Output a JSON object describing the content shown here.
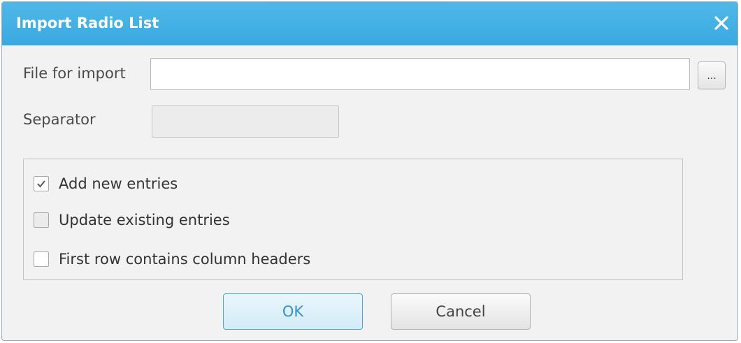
{
  "dialog": {
    "title": "Import Radio List",
    "close_icon": "close-icon"
  },
  "form": {
    "file_label": "File for import",
    "file_value": "",
    "browse_label": "...",
    "separator_label": "Separator",
    "separator_value": ""
  },
  "options": [
    {
      "label": "Add new entries",
      "checked": true,
      "enabled": true
    },
    {
      "label": "Update existing entries",
      "checked": false,
      "enabled": false
    },
    {
      "label": "First row contains column headers",
      "checked": false,
      "enabled": true
    }
  ],
  "buttons": {
    "ok_label": "OK",
    "cancel_label": "Cancel"
  },
  "colors": {
    "titlebar": "#3aa9e0",
    "ok_text": "#2f93cf",
    "dialog_bg": "#f2f2f2"
  }
}
